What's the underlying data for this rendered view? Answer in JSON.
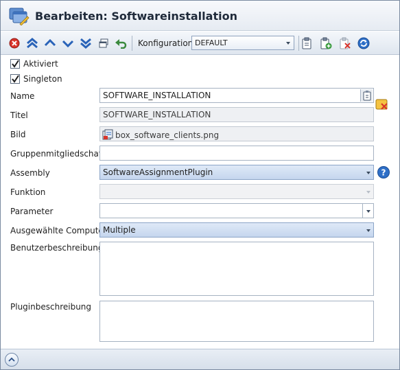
{
  "window": {
    "title": "Bearbeiten: Softwareinstallation"
  },
  "toolbar": {
    "buttons": [
      "delete-icon",
      "move-top-icon",
      "move-up-icon",
      "move-down-icon",
      "move-bottom-icon",
      "window-icon",
      "undo-icon",
      "clipboard-icon",
      "clipboard-add-icon",
      "clipboard-delete-icon",
      "refresh-icon"
    ],
    "konfiguration_label": "Konfiguration",
    "konfiguration_value": "DEFAULT"
  },
  "checks": {
    "aktiviert": {
      "label": "Aktiviert",
      "checked": true
    },
    "singleton": {
      "label": "Singleton",
      "checked": true
    }
  },
  "form": {
    "name": {
      "label": "Name",
      "value": "SOFTWARE_INSTALLATION"
    },
    "titel": {
      "label": "Titel",
      "value": "SOFTWARE_INSTALLATION"
    },
    "bild": {
      "label": "Bild",
      "value": "box_software_clients.png"
    },
    "gruppen": {
      "label": "Gruppenmitgliedschaft",
      "value": ""
    },
    "assembly": {
      "label": "Assembly",
      "value": "SoftwareAssignmentPlugin"
    },
    "funktion": {
      "label": "Funktion",
      "value": ""
    },
    "parameter": {
      "label": "Parameter",
      "value": ""
    },
    "computer": {
      "label": "Ausgewählte Computer",
      "value": "Multiple"
    },
    "benutzer": {
      "label": "Benutzerbeschreibung",
      "value": ""
    },
    "plugin": {
      "label": "Pluginbeschreibung",
      "value": ""
    }
  },
  "colors": {
    "accent": "#2b6cc4",
    "delete": "#d9342b",
    "help": "#2e6fc7"
  }
}
